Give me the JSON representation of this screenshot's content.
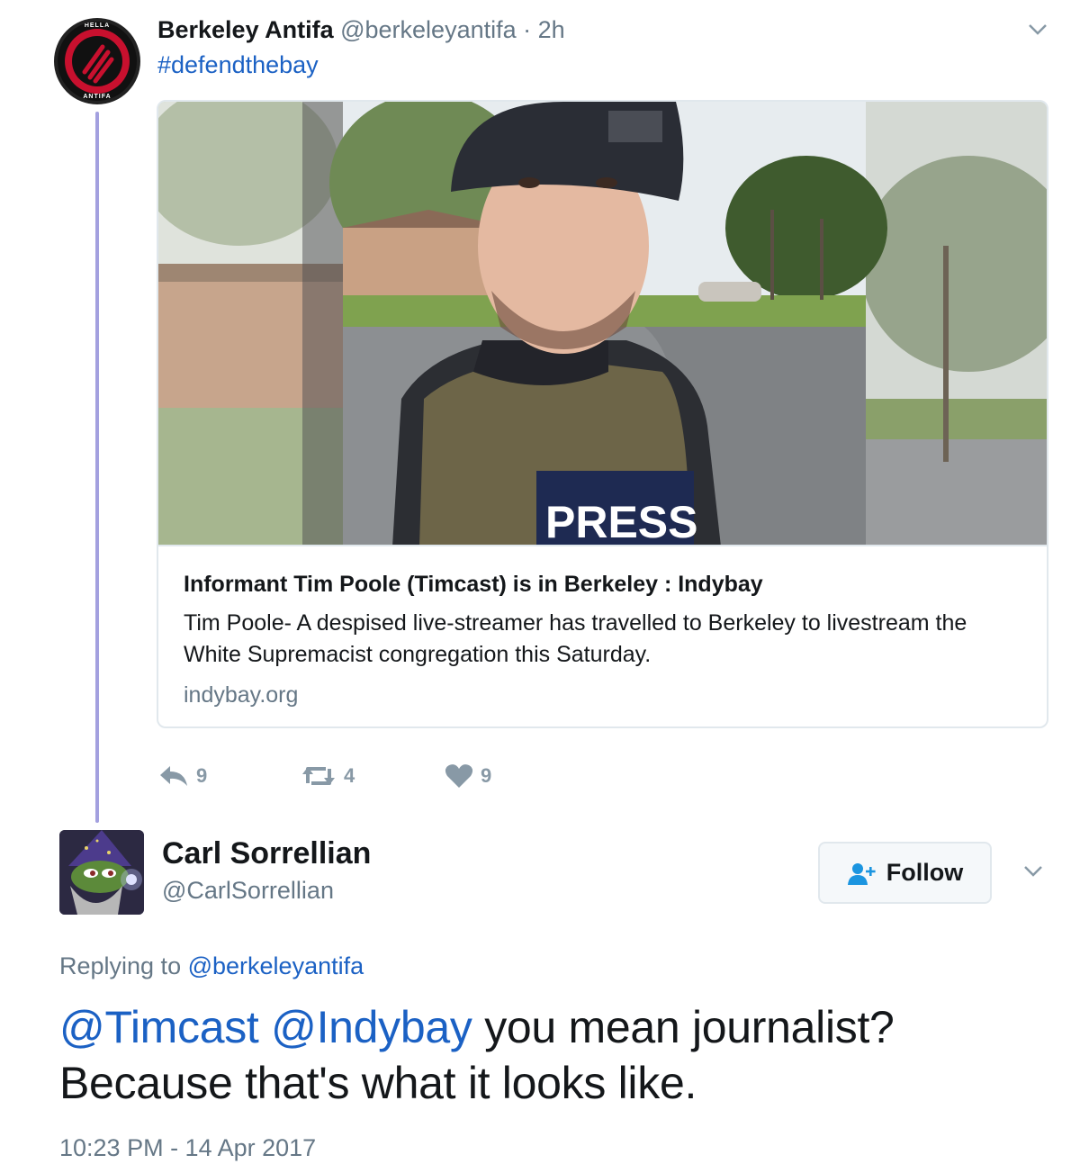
{
  "original_tweet": {
    "display_name": "Berkeley Antifa",
    "handle": "@berkeleyantifa",
    "separator": "·",
    "time_ago": "2h",
    "text": "#defendthebay",
    "avatar_top_text": "HELLA",
    "avatar_bottom_text": "ANTIFA",
    "card": {
      "title": "Informant Tim Poole (Timcast) is in Berkeley : Indybay",
      "description": "Tim Poole- A despised live-streamer has travelled to Berkeley to livestream the White Supremacist congregation this Saturday.",
      "domain": "indybay.org",
      "image_alt": "Selfie of a man in a beanie and PRESS vest",
      "vest_text": "PRESS"
    },
    "actions": {
      "replies": "9",
      "retweets": "4",
      "likes": "9"
    }
  },
  "reply_tweet": {
    "display_name": "Carl Sorrellian",
    "handle": "@CarlSorrellian",
    "follow_label": "Follow",
    "replying_prefix": "Replying to",
    "replying_to": "@berkeleyantifa",
    "mention_1": "@Timcast",
    "mention_2": "@Indybay",
    "text_line1_rest": "you mean journalist?",
    "text_line2": "Because that's what it looks like.",
    "timestamp": "10:23 PM - 14 Apr 2017"
  },
  "colors": {
    "link": "#1b61c4",
    "muted": "#657786",
    "thread_line": "#a3a0df",
    "border": "#e1e8ed"
  }
}
